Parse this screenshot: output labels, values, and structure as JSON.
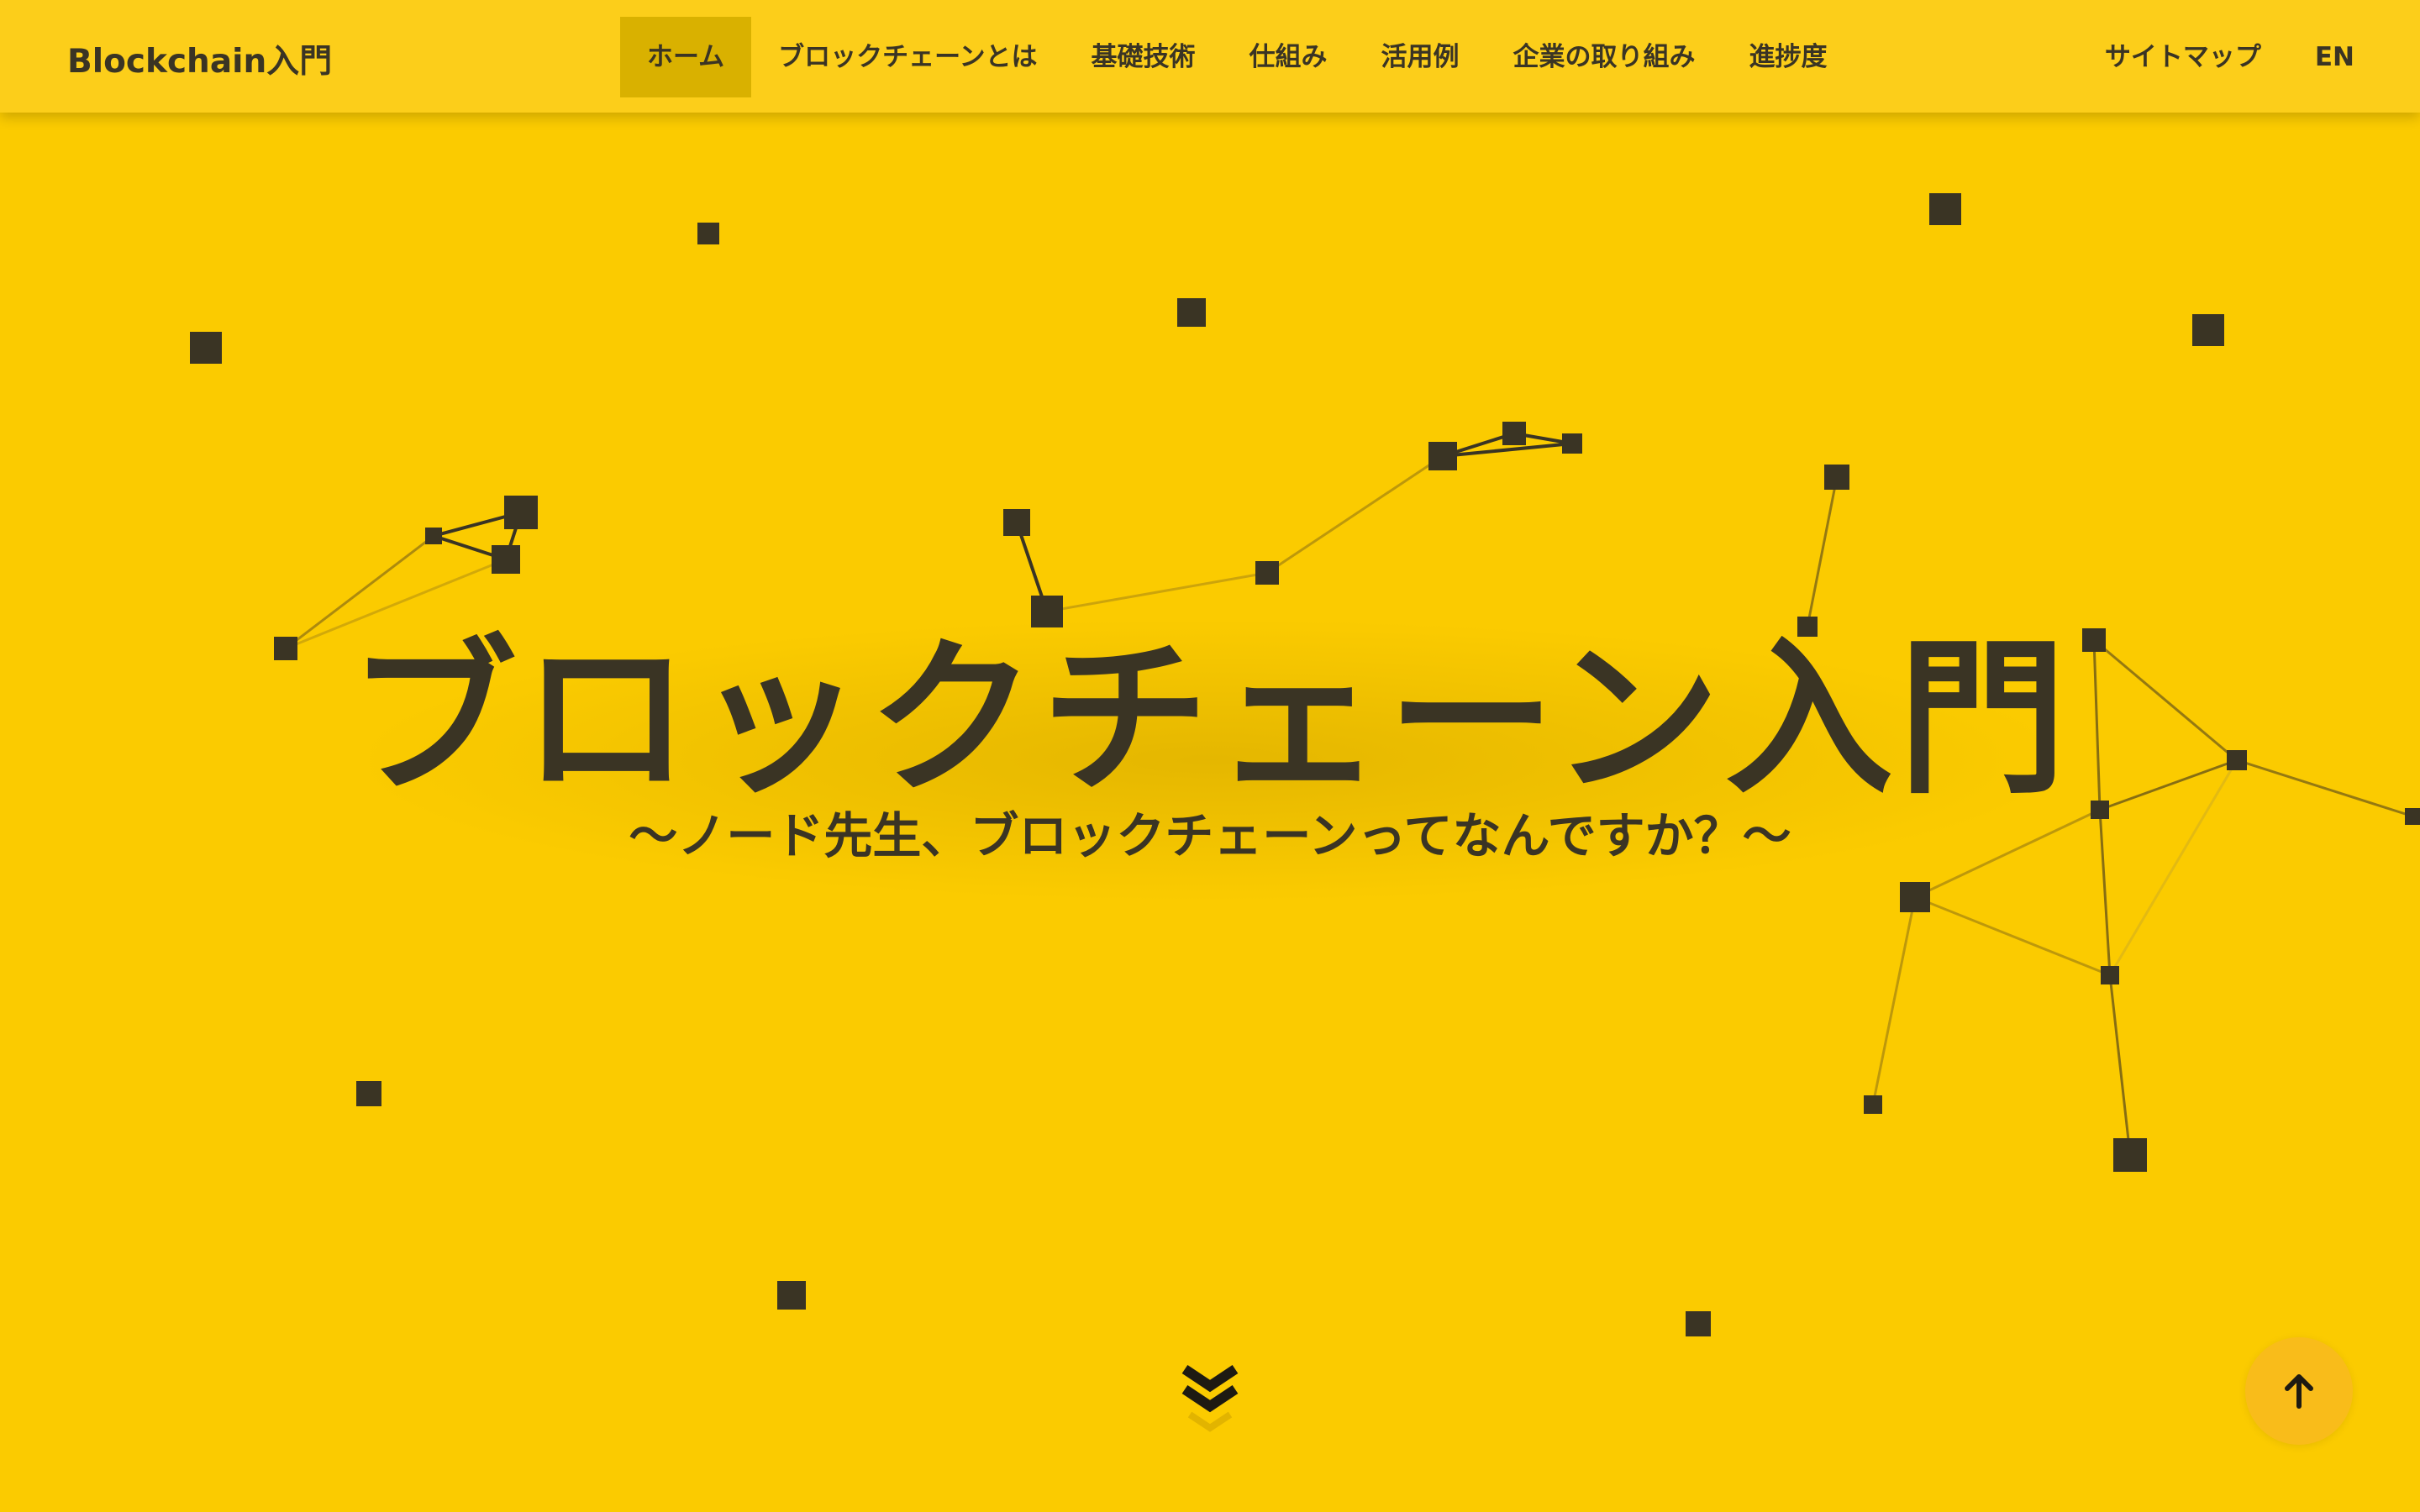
{
  "header": {
    "logo": "Blockchain入門",
    "nav": [
      {
        "label": "ホーム",
        "active": true
      },
      {
        "label": "ブロックチェーンとは",
        "active": false
      },
      {
        "label": "基礎技術",
        "active": false
      },
      {
        "label": "仕組み",
        "active": false
      },
      {
        "label": "活用例",
        "active": false
      },
      {
        "label": "企業の取り組み",
        "active": false
      },
      {
        "label": "進捗度",
        "active": false
      }
    ],
    "sitemap": "サイトマップ",
    "lang": "EN"
  },
  "hero": {
    "title": "ブロックチェーン入門",
    "subtitle": "〜ノード先生、ブロックチェーンってなんですか？〜"
  },
  "icons": {
    "scroll": "chevron-double-down-icon",
    "back_to_top": "arrow-up-icon"
  },
  "colors": {
    "background": "#FBCB00",
    "header": "#FCCE1A",
    "text": "#3A3424",
    "nav_active": "#D9B100",
    "node": "#3A3424",
    "back_to_top": "#F9BC1A"
  }
}
